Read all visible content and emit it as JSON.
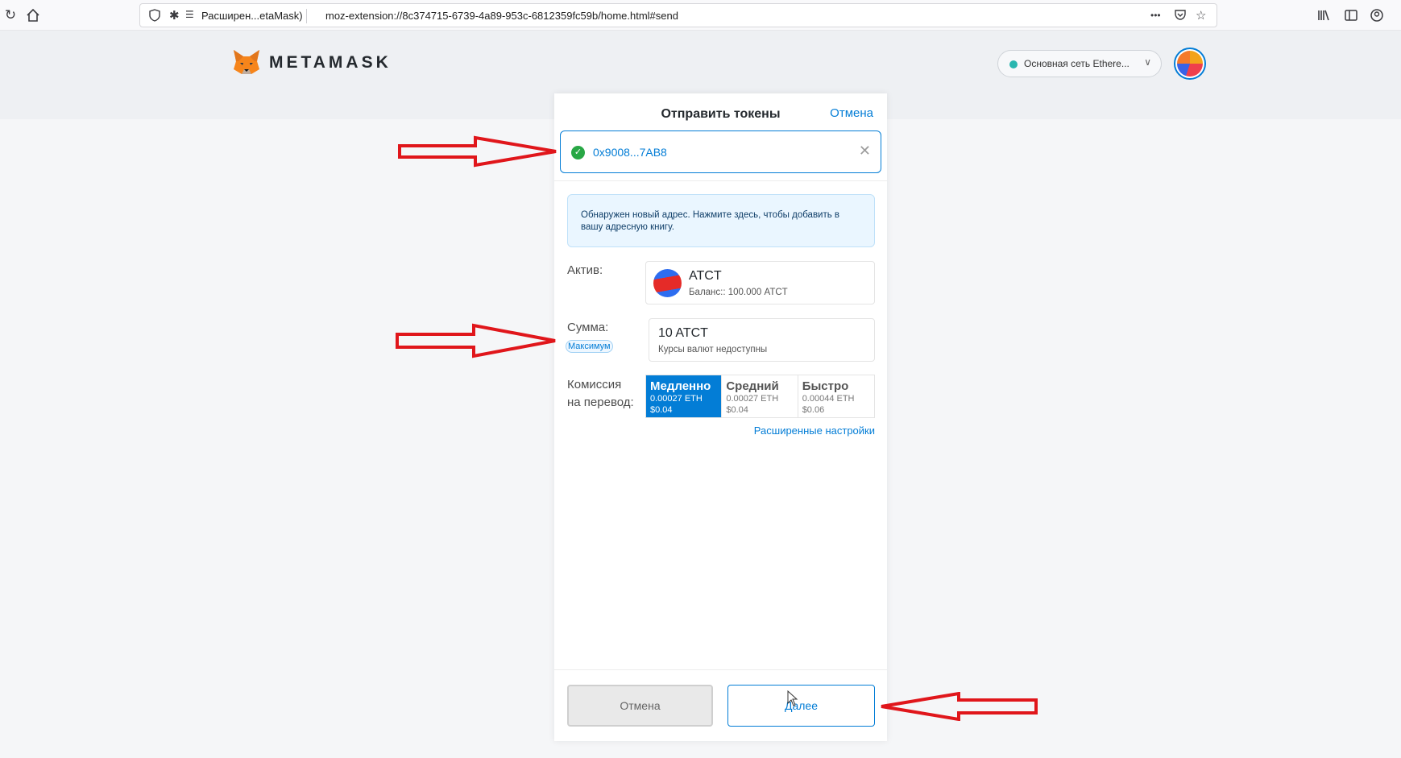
{
  "browser": {
    "extension_label": "Расширен...etaMask)",
    "url": "moz-extension://8c374715-6739-4a89-953c-6812359fc59b/home.html#send",
    "more_label": "•••"
  },
  "header": {
    "logo_text": "METAMASK",
    "network_label": "Основная сеть Ethere...",
    "network_color": "#29b6af"
  },
  "send": {
    "title": "Отправить токены",
    "cancel_link": "Отмена",
    "recipient": {
      "address": "0x9008...7AB8",
      "status_icon": "check-circle-icon"
    },
    "notice": "Обнаружен новый адрес. Нажмите здесь, чтобы добавить в вашу адресную книгу.",
    "asset": {
      "label": "Актив:",
      "symbol": "ATCT",
      "balance": "Баланс:: 100.000 ATCT"
    },
    "amount": {
      "label": "Сумма:",
      "max_label": "Максимум",
      "value": "10 ATCT",
      "sub": "Курсы валют недоступны"
    },
    "fee": {
      "label_line1": "Комиссия",
      "label_line2": "на перевод:",
      "options": [
        {
          "name": "Медленно",
          "eth": "0.00027 ETH",
          "usd": "$0.04",
          "selected": true
        },
        {
          "name": "Средний",
          "eth": "0.00027 ETH",
          "usd": "$0.04",
          "selected": false
        },
        {
          "name": "Быстро",
          "eth": "0.00044 ETH",
          "usd": "$0.06",
          "selected": false
        }
      ],
      "advanced_link": "Расширенные настройки"
    },
    "buttons": {
      "cancel": "Отмена",
      "next": "Далее"
    }
  },
  "colors": {
    "accent": "#037dd6",
    "annotation_arrow": "#e0161b",
    "success": "#28a745"
  }
}
